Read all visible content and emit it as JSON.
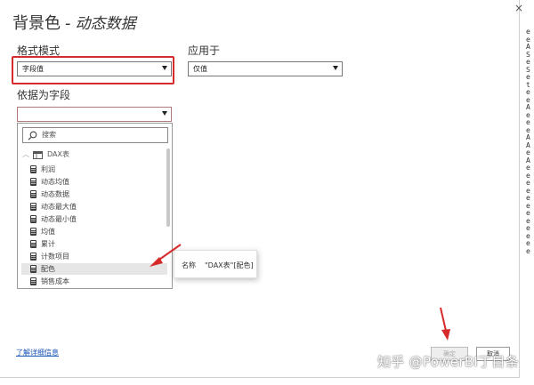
{
  "dialog": {
    "close_glyph": "×",
    "title_main": "背景色",
    "title_separator": "-",
    "title_sub": "动态数据"
  },
  "format_mode": {
    "label": "格式模式",
    "value": "字段值"
  },
  "apply_to": {
    "label": "应用于",
    "value": "仅值"
  },
  "based_on_field": {
    "label": "依据为字段",
    "value": ""
  },
  "field_list": {
    "search_placeholder": "搜索",
    "table_name": "DAX表",
    "items": [
      {
        "label": "利润"
      },
      {
        "label": "动态均值"
      },
      {
        "label": "动态数据"
      },
      {
        "label": "动态最大值"
      },
      {
        "label": "动态最小值"
      },
      {
        "label": "均值"
      },
      {
        "label": "累计"
      },
      {
        "label": "计数项目"
      },
      {
        "label": "配色",
        "selected": true
      },
      {
        "label": "销售成本"
      }
    ]
  },
  "tooltip": {
    "key": "名称",
    "value": "\"DAX表\"[配色]"
  },
  "footer": {
    "learn_more": "了解详细信息",
    "ok": "确定",
    "cancel": "取消"
  },
  "right_strip": [
    "e",
    "e",
    "A",
    "S",
    "e",
    "S",
    "e",
    "t",
    "e",
    "e",
    "A",
    "e",
    "e",
    "e",
    "A",
    "A",
    "e",
    "A",
    "e",
    "e",
    "e",
    "e",
    "e",
    "e",
    "e",
    "e",
    "e",
    "e",
    "e",
    "e"
  ],
  "watermark": "知乎 @PowerBI丁目条",
  "colors": {
    "highlight_border": "#d52b2b",
    "arrow": "#d52b2b",
    "link": "#1a56b8"
  }
}
